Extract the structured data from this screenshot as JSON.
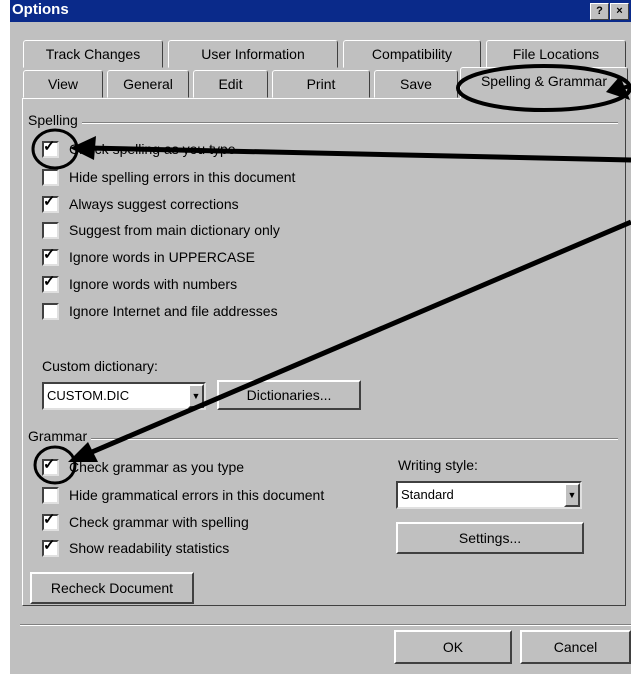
{
  "window": {
    "title": "Options",
    "help_icon": "?",
    "close_icon": "×"
  },
  "tabs_back": [
    "Track Changes",
    "User Information",
    "Compatibility",
    "File Locations"
  ],
  "tabs_front": [
    "View",
    "General",
    "Edit",
    "Print",
    "Save",
    "Spelling & Grammar"
  ],
  "spelling": {
    "label": "Spelling",
    "options": [
      {
        "label": "Check spelling as you type",
        "checked": true
      },
      {
        "label": "Hide spelling errors in this document",
        "checked": false
      },
      {
        "label": "Always suggest corrections",
        "checked": true
      },
      {
        "label": "Suggest from main dictionary only",
        "checked": false
      },
      {
        "label": "Ignore words in UPPERCASE",
        "checked": true
      },
      {
        "label": "Ignore words with numbers",
        "checked": true
      },
      {
        "label": "Ignore Internet and file addresses",
        "checked": false
      }
    ],
    "custom_dictionary_label": "Custom dictionary:",
    "custom_dictionary_value": "CUSTOM.DIC",
    "dictionaries_button": "Dictionaries..."
  },
  "grammar": {
    "label": "Grammar",
    "options": [
      {
        "label": "Check grammar as you type",
        "checked": true
      },
      {
        "label": "Hide grammatical errors in this document",
        "checked": false
      },
      {
        "label": "Check grammar with spelling",
        "checked": true
      },
      {
        "label": "Show readability statistics",
        "checked": true
      }
    ],
    "writing_style_label": "Writing style:",
    "writing_style_value": "Standard",
    "settings_button": "Settings..."
  },
  "recheck_button": "Recheck Document",
  "footer": {
    "ok": "OK",
    "cancel": "Cancel"
  }
}
